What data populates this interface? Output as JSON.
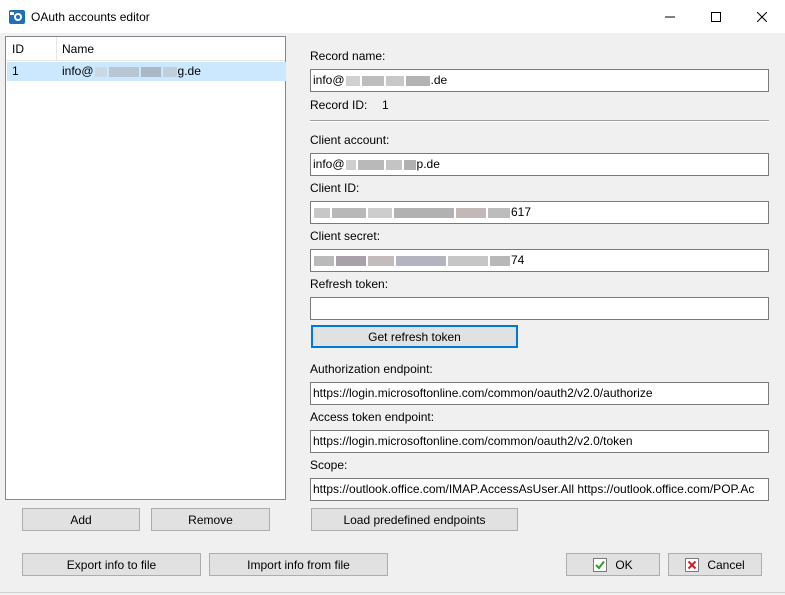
{
  "window": {
    "title": "OAuth accounts editor",
    "app_icon": "oauth-app-icon"
  },
  "accounts_list": {
    "columns": [
      "ID",
      "Name"
    ],
    "rows": [
      {
        "id": "1",
        "name_prefix": "info@",
        "name_suffix": "g.de"
      }
    ]
  },
  "form": {
    "record_name_label": "Record name:",
    "record_name_prefix": "info@",
    "record_name_suffix": ".de",
    "record_id_label": "Record ID:",
    "record_id_value": "1",
    "client_account_label": "Client account:",
    "client_account_prefix": "info@",
    "client_account_suffix": "p.de",
    "client_id_label": "Client ID:",
    "client_id_suffix": "617",
    "client_secret_label": "Client secret:",
    "client_secret_suffix": "74",
    "refresh_token_label": "Refresh token:",
    "refresh_token_value": "",
    "get_refresh_token_label": "Get refresh token",
    "auth_endpoint_label": "Authorization endpoint:",
    "auth_endpoint_value": "https://login.microsoftonline.com/common/oauth2/v2.0/authorize",
    "token_endpoint_label": "Access token endpoint:",
    "token_endpoint_value": "https://login.microsoftonline.com/common/oauth2/v2.0/token",
    "scope_label": "Scope:",
    "scope_value": "https://outlook.office.com/IMAP.AccessAsUser.All https://outlook.office.com/POP.Ac"
  },
  "buttons": {
    "add": "Add",
    "remove": "Remove",
    "load_predefined": "Load predefined endpoints",
    "export": "Export info to file",
    "import": "Import info from file",
    "ok": "OK",
    "cancel": "Cancel"
  },
  "colors": {
    "selection": "#cce8ff",
    "focus_border": "#0078d7",
    "ok_icon": "#2e9d2e",
    "cancel_icon": "#d42020"
  }
}
